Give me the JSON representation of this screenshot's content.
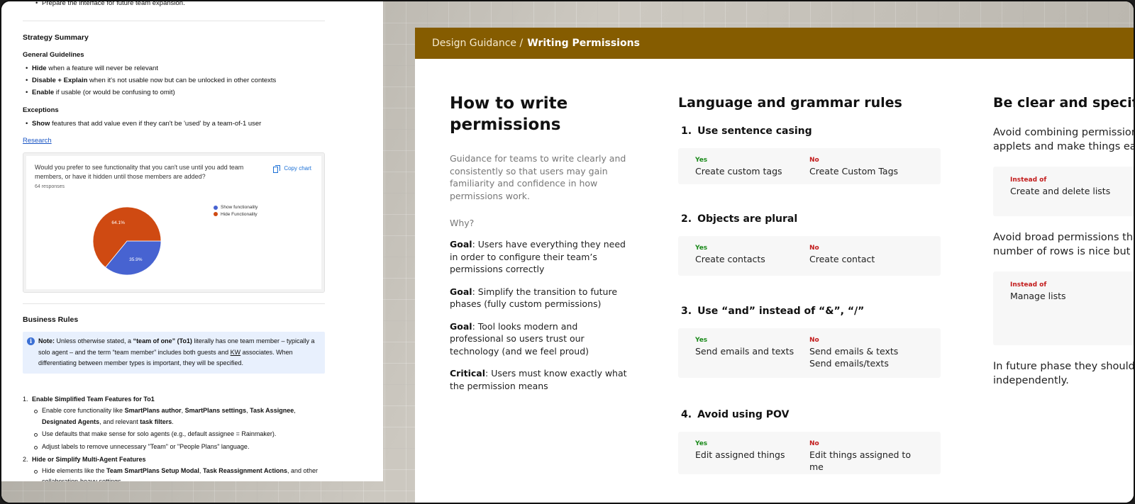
{
  "doc": {
    "cut_bullet": "Prepare the interface for future team expansion.",
    "strategy_title": "Strategy Summary",
    "general_title": "General Guidelines",
    "general_items": [
      {
        "bold": "Hide",
        "text": " when a feature will never be relevant"
      },
      {
        "bold": "Disable + Explain",
        "text": " when it's not usable now but can be unlocked in other contexts"
      },
      {
        "bold": "Enable",
        "text": " if usable (or would be confusing to omit)"
      }
    ],
    "exceptions_title": "Exceptions",
    "exception_item": {
      "bold": "Show",
      "text": " features that add value even if they can't be 'used' by a team-of-1 user"
    },
    "research_link": "Research",
    "chart_question": "Would you prefer to see functionality that you can't use until you add team members, or have it hidden until those members are added?",
    "chart_responses": "64 responses",
    "copy_chart": "Copy chart",
    "business_title": "Business Rules",
    "note": {
      "label": "Note:",
      "t1": " Unless otherwise stated, a ",
      "b1": "“team of one” (To1)",
      "t2": " literally has one team member – typically a solo agent – and the term “team member” includes both guests and ",
      "kw": "KW",
      "t3": " associates. When differentiating between member types is important, they will be specified."
    },
    "rule1": {
      "num": "1.",
      "title": "Enable Simplified Team Features for To1",
      "sub1": {
        "t1": "Enable core functionality like ",
        "b1": "SmartPlans author",
        "t2": ", ",
        "b2": "SmartPlans settings",
        "t3": ", ",
        "b3": "Task Assignee",
        "t4": ", ",
        "b4": "Designated Agents",
        "t5": ", and relevant ",
        "b5": "task filters",
        "t6": "."
      },
      "sub2": "Use defaults that make sense for solo agents (e.g., default assignee = Rainmaker).",
      "sub3": "Adjust labels to remove unnecessary \"Team\" or \"People Plans\" language."
    },
    "rule2": {
      "num": "2.",
      "title": "Hide or Simplify Multi-Agent Features",
      "sub1": {
        "t1": "Hide elements like the ",
        "b1": "Team SmartPlans Setup Modal",
        "t2": ", ",
        "b2": "Task Reassignment Actions",
        "t3": ", and other collaboration-heavy settings."
      }
    }
  },
  "chart_data": {
    "type": "pie",
    "title": "",
    "slices": [
      {
        "name": "Show functionality",
        "value": 35.9,
        "label": "35.9%",
        "color": "#4763d1"
      },
      {
        "name": "Hide Functionality",
        "value": 64.1,
        "label": "64.1%",
        "color": "#cf4a12"
      }
    ],
    "legend": "right"
  },
  "guide": {
    "breadcrumb": "Design Guidance /",
    "current": "Writing Permissions",
    "accent": "#855c00",
    "title": "How to write permissions",
    "lead": "Guidance for teams to write clearly and consistently so that users may gain familiarity and confidence in how permissions work.",
    "why": "Why?",
    "goals": [
      {
        "label": "Goal",
        "text": ": Users have everything they need in order to configure their team’s permissions correctly"
      },
      {
        "label": "Goal",
        "text": ": Simplify the transition to future phases (fully custom permissions)"
      },
      {
        "label": "Goal",
        "text": ": Tool looks modern and professional so users trust our technology (and we feel proud)"
      },
      {
        "label": "Critical",
        "text": ": Users must know exactly what the permission means"
      }
    ],
    "lang_title": "Language and grammar rules",
    "yes_label": "Yes",
    "no_label": "No",
    "rules": [
      {
        "num": "1.",
        "title": "Use sentence casing",
        "yes": "Create custom tags",
        "no": "Create Custom Tags",
        "no2": ""
      },
      {
        "num": "2.",
        "title": "Objects are plural",
        "yes": "Create contacts",
        "no": "Create contact",
        "no2": ""
      },
      {
        "num": "3.",
        "title": "Use “and” instead of “&”, “/”",
        "yes": "Send emails and texts",
        "no": "Send emails & texts",
        "no2": "Send emails/texts"
      },
      {
        "num": "4.",
        "title": "Avoid using POV",
        "yes": "Edit assigned things",
        "no": "Edit things assigned to me",
        "no2": ""
      }
    ],
    "clear_title": "Be clear and specific",
    "clear_p1": "Avoid combining permissions. ",
    "clear_p1b": "applets and make things easie",
    "instead_label": "Instead of",
    "instead1": "Create and delete lists",
    "clear_p2": "Avoid broad permissions that r",
    "clear_p2b": "number of rows is nice but not",
    "instead2": "Manage lists",
    "clear_p3": "In future phase they should be",
    "clear_p3b": "independently."
  }
}
